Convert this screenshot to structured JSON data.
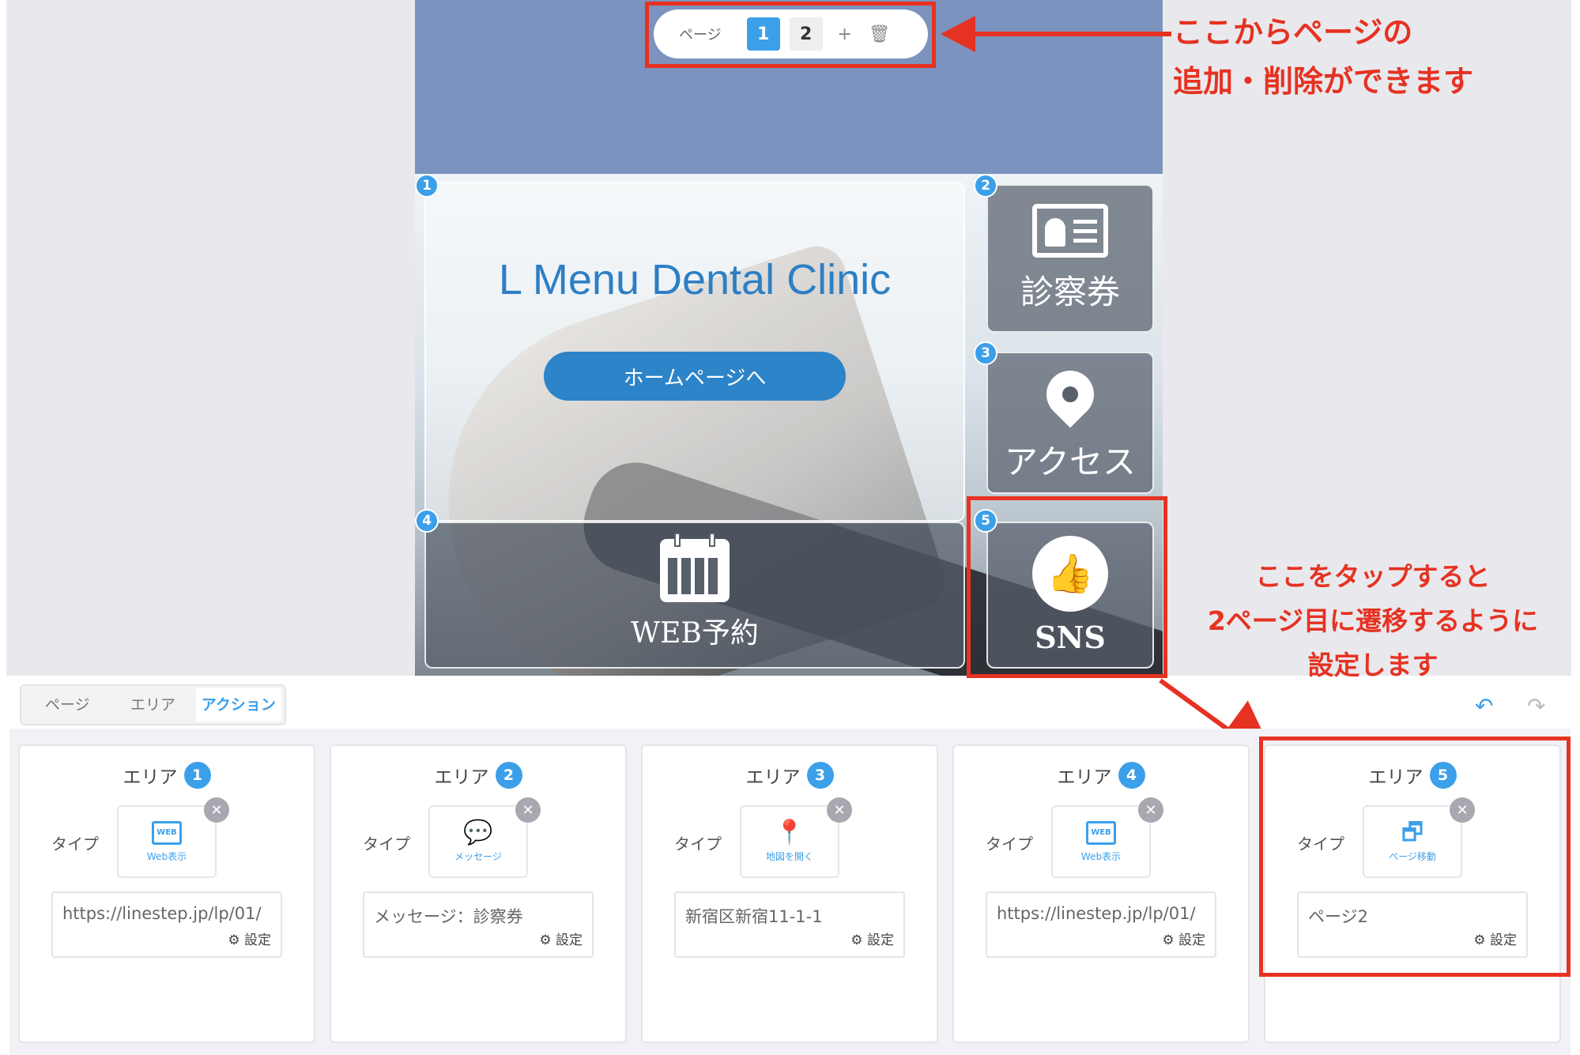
{
  "page_bar": {
    "label": "ページ",
    "pages": [
      "1",
      "2"
    ],
    "add": "+",
    "delete": "🗑"
  },
  "annotations": {
    "top": "ここからページの\n追加・削除ができます",
    "side": "ここをタップすると\n2ページ目に遷移するように\n設定します"
  },
  "canvas": {
    "areas": [
      {
        "num": "1",
        "title": "L Menu Dental Clinic",
        "button": "ホームページへ"
      },
      {
        "num": "2",
        "icon": "id-card-icon",
        "label": "診察券"
      },
      {
        "num": "3",
        "icon": "map-pin-icon",
        "label": "アクセス"
      },
      {
        "num": "4",
        "icon": "calendar-icon",
        "label": "WEB予約"
      },
      {
        "num": "5",
        "icon": "thumbs-up-icon",
        "label": "SNS"
      }
    ]
  },
  "tabs": [
    "ページ",
    "エリア",
    "アクション"
  ],
  "cards": [
    {
      "title": "エリア",
      "num": "1",
      "type_label": "タイプ",
      "icon_text": "WEB",
      "type_name": "Web表示",
      "value": "https://linestep.jp/lp/01/",
      "setting": "⚙ 設定"
    },
    {
      "title": "エリア",
      "num": "2",
      "type_label": "タイプ",
      "icon_text": "💬",
      "type_name": "メッセージ",
      "value": "メッセージ：診察券",
      "setting": "⚙ 設定"
    },
    {
      "title": "エリア",
      "num": "3",
      "type_label": "タイプ",
      "icon_text": "📍",
      "type_name": "地図を開く",
      "value": "新宿区新宿11-1-1",
      "setting": "⚙ 設定"
    },
    {
      "title": "エリア",
      "num": "4",
      "type_label": "タイプ",
      "icon_text": "WEB",
      "type_name": "Web表示",
      "value": "https://linestep.jp/lp/01/",
      "setting": "⚙ 設定"
    },
    {
      "title": "エリア",
      "num": "5",
      "type_label": "タイプ",
      "icon_text": "🗗",
      "type_name": "ページ移動",
      "value": "ページ2",
      "setting": "⚙ 設定"
    }
  ],
  "undo": "↶",
  "redo": "↷",
  "colors": {
    "accent": "#3c9fea",
    "callout": "#e63222",
    "header": "#7b93be"
  }
}
